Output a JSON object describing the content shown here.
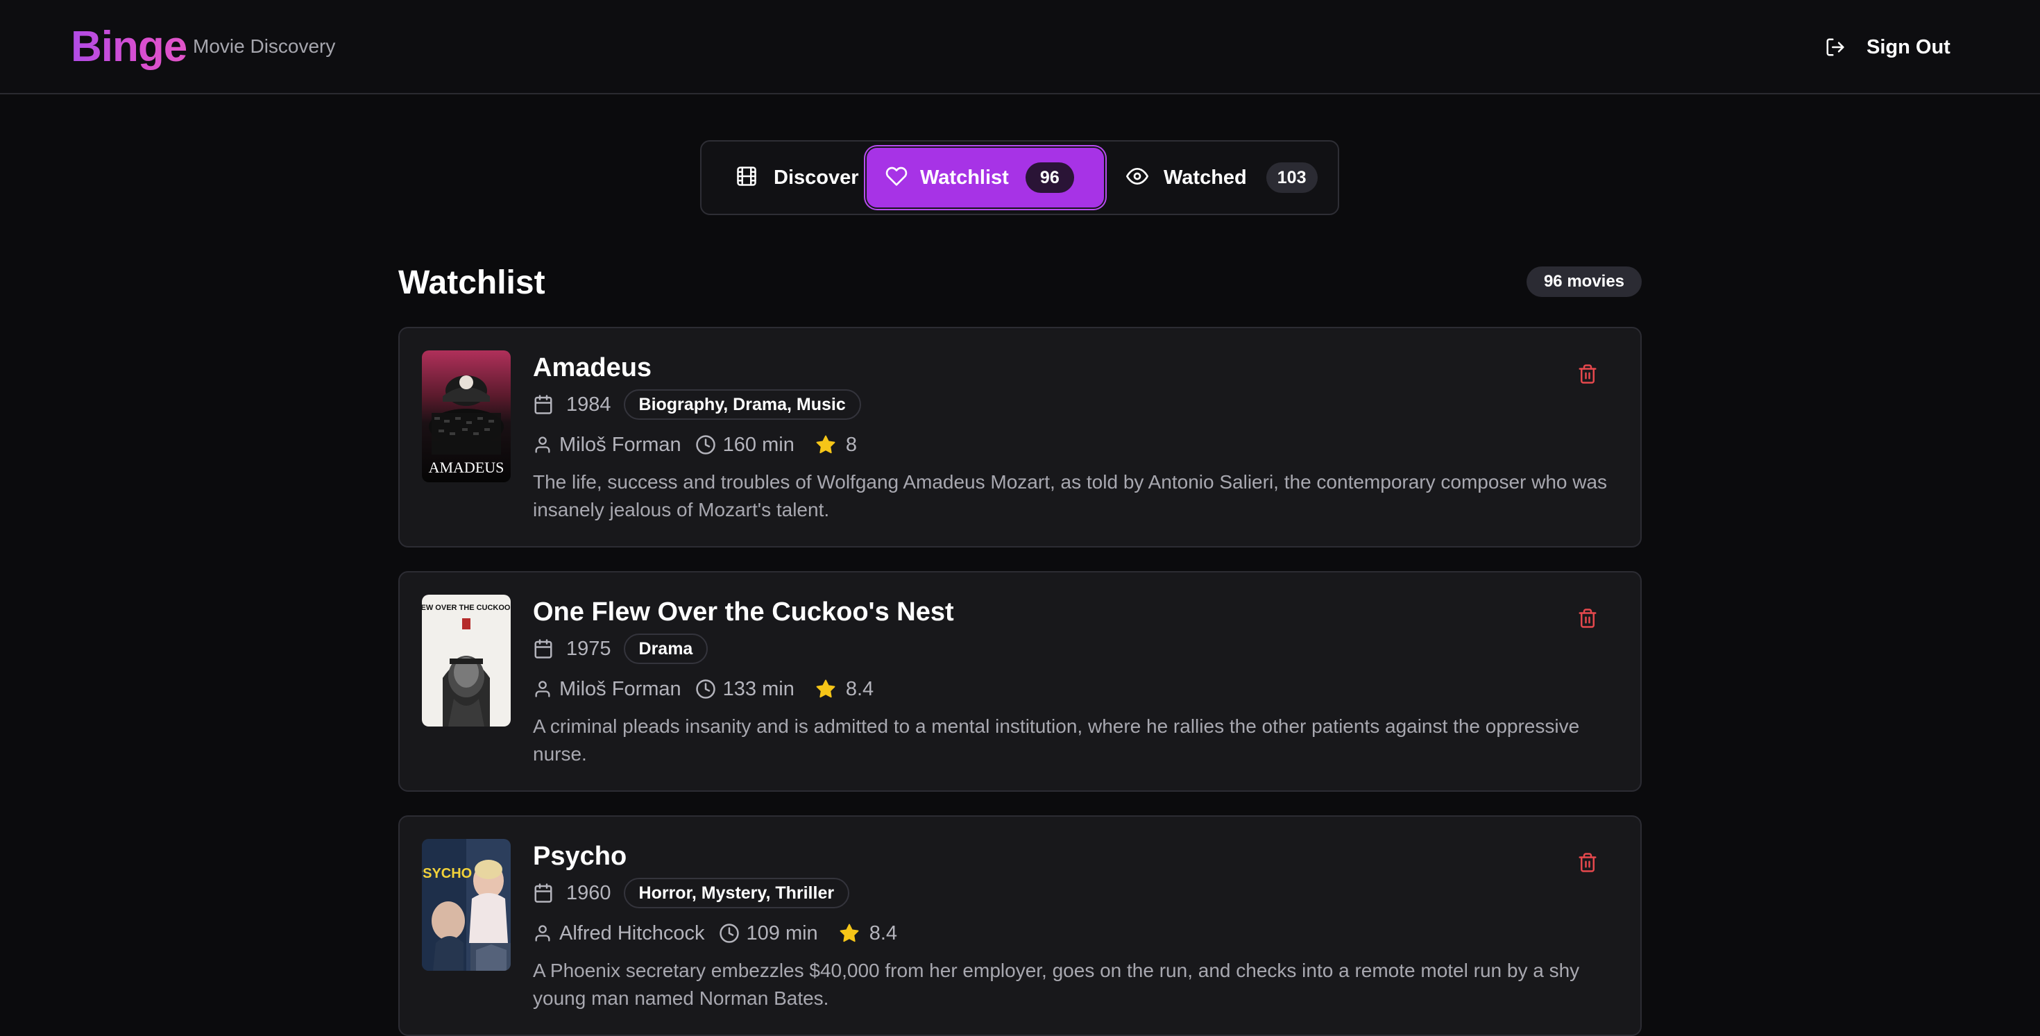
{
  "header": {
    "logo": "Binge",
    "tagline": "Movie Discovery",
    "signout_label": "Sign Out",
    "signout_icon": "log-out-icon"
  },
  "tabs": [
    {
      "label": "Discover",
      "icon": "film-icon",
      "active": false
    },
    {
      "label": "Watchlist",
      "icon": "heart-icon",
      "count": "96",
      "active": true
    },
    {
      "label": "Watched",
      "icon": "eye-icon",
      "count": "103",
      "active": false
    }
  ],
  "section": {
    "title": "Watchlist",
    "total": "96 movies"
  },
  "movies": [
    {
      "title": "Amadeus",
      "year": "1984",
      "genres": "Biography, Drama, Music",
      "director": "Miloš Forman",
      "runtime": "160 min",
      "rating": "8",
      "description": "The life, success and troubles of Wolfgang Amadeus Mozart, as told by Antonio Salieri, the contemporary composer who was insanely jealous of Mozart's talent.",
      "poster_text": "AMADEUS"
    },
    {
      "title": "One Flew Over the Cuckoo's Nest",
      "year": "1975",
      "genres": "Drama",
      "director": "Miloš Forman",
      "runtime": "133 min",
      "rating": "8.4",
      "description": "A criminal pleads insanity and is admitted to a mental institution, where he rallies the other patients against the oppressive nurse.",
      "poster_text": "ONE FLEW OVER THE CUCKOO'S NEST"
    },
    {
      "title": "Psycho",
      "year": "1960",
      "genres": "Horror, Mystery, Thriller",
      "director": "Alfred Hitchcock",
      "runtime": "109 min",
      "rating": "8.4",
      "description": "A Phoenix secretary embezzles $40,000 from her employer, goes on the run, and checks into a remote motel run by a shy young man named Norman Bates.",
      "poster_text": "PSYCHO"
    }
  ],
  "colors": {
    "accent": "#a733e6",
    "logo_gradient_start": "#b04ce6",
    "logo_gradient_end": "#e055c8",
    "delete": "#e5484d",
    "star": "#f5c518",
    "background": "#0b0b0d",
    "card": "#18181b"
  }
}
